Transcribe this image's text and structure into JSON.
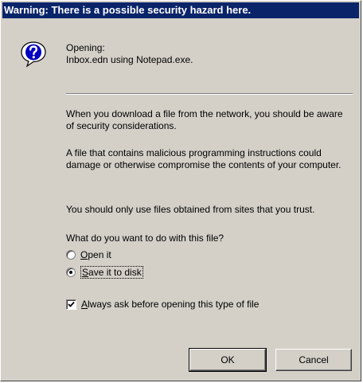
{
  "window": {
    "title": "Warning:  There is a possible security hazard here."
  },
  "header": {
    "line1": "Opening:",
    "line2": "Inbox.edn using Notepad.exe."
  },
  "body": {
    "para1": "When you download a file from the network, you should be aware of security considerations.",
    "para2": "A file that contains malicious programming instructions could damage or otherwise compromise the contents of your computer.",
    "para3": "You should only use files obtained from sites that you trust.",
    "question": "What do you want to do with this file?"
  },
  "options": {
    "open_it": {
      "accel": "O",
      "rest": "pen it",
      "selected": false
    },
    "save_it": {
      "accel": "S",
      "rest": "ave it to disk",
      "selected": true
    }
  },
  "always_ask": {
    "accel": "A",
    "rest": "lways ask before opening this type of file",
    "checked": true
  },
  "buttons": {
    "ok": "OK",
    "cancel": "Cancel"
  },
  "colors": {
    "titlebar": "#0a246a",
    "face": "#d4d0c8"
  },
  "icons": {
    "header": "question-mark-icon"
  }
}
